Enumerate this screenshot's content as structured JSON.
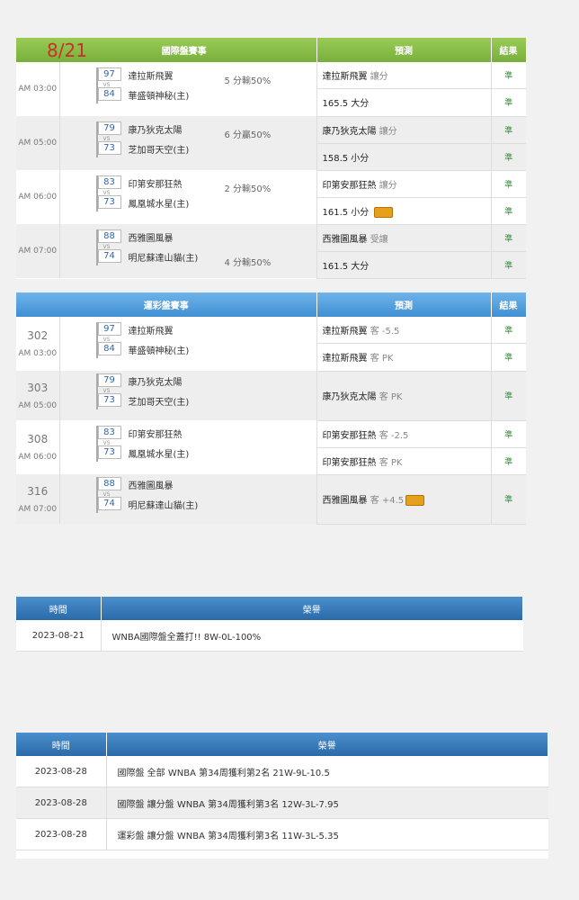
{
  "intl": {
    "date": "8/21",
    "col_match": "國際盤賽事",
    "col_pred": "預測",
    "col_result": "結果",
    "games": [
      {
        "time": "AM 03:00",
        "s1": "97",
        "s2": "84",
        "t1": "達拉斯飛翼",
        "t2": "華盛頓神秘(主)",
        "note": "5 分輸50%",
        "p1": "達拉斯飛翼",
        "p1s": "讓分",
        "p2": "165.5 大分",
        "p2s": "",
        "p2badge": false,
        "r1": "準",
        "r2": "準"
      },
      {
        "time": "AM 05:00",
        "s1": "79",
        "s2": "73",
        "t1": "康乃狄克太陽",
        "t2": "芝加哥天空(主)",
        "note": "6 分贏50%",
        "p1": "康乃狄克太陽",
        "p1s": "讓分",
        "p2": "158.5 小分",
        "p2s": "",
        "p2badge": false,
        "r1": "準",
        "r2": "準"
      },
      {
        "time": "AM 06:00",
        "s1": "83",
        "s2": "73",
        "t1": "印第安那狂熱",
        "t2": "鳳凰城水星(主)",
        "note": "2 分輸50%",
        "p1": "印第安那狂熱",
        "p1s": "讓分",
        "p2": "161.5 小分",
        "p2s": "",
        "p2badge": true,
        "r1": "準",
        "r2": "準"
      },
      {
        "time": "AM 07:00",
        "s1": "88",
        "s2": "74",
        "t1": "西雅圖風暴",
        "t2": "明尼蘇達山貓(主)",
        "note": "4 分輸50%",
        "p1": "西雅圖風暴",
        "p1s": "受讓",
        "p2": "161.5 大分",
        "p2s": "",
        "p2badge": false,
        "r1": "準",
        "r2": "準"
      }
    ]
  },
  "sport": {
    "col_match": "運彩盤賽事",
    "col_pred": "預測",
    "col_result": "結果",
    "games": [
      {
        "num": "302",
        "time": "AM 03:00",
        "s1": "97",
        "s2": "84",
        "t1": "達拉斯飛翼",
        "t2": "華盛頓神秘(主)",
        "p1": "達拉斯飛翼",
        "p1s": "客 -5.5",
        "p2": "達拉斯飛翼",
        "p2s": "客 PK",
        "r1": "準",
        "r2": "準"
      },
      {
        "num": "303",
        "time": "AM 05:00",
        "s1": "79",
        "s2": "73",
        "t1": "康乃狄克太陽",
        "t2": "芝加哥天空(主)",
        "p1": "康乃狄克太陽",
        "p1s": "客 PK",
        "r1": "準"
      },
      {
        "num": "308",
        "time": "AM 06:00",
        "s1": "83",
        "s2": "73",
        "t1": "印第安那狂熱",
        "t2": "鳳凰城水星(主)",
        "p1": "印第安那狂熱",
        "p1s": "客 -2.5",
        "p2": "印第安那狂熱",
        "p2s": "客 PK",
        "r1": "準",
        "r2": "準"
      },
      {
        "num": "316",
        "time": "AM 07:00",
        "s1": "88",
        "s2": "74",
        "t1": "西雅圖風暴",
        "t2": "明尼蘇達山貓(主)",
        "p1": "西雅圖風暴",
        "p1s": "客 +4.5",
        "p1badge": true,
        "r1": "準"
      }
    ]
  },
  "honor1": {
    "col_time": "時間",
    "col_honor": "榮譽",
    "rows": [
      {
        "date": "2023-08-21",
        "text": "WNBA國際盤全蓋打!! 8W-0L-100%"
      }
    ]
  },
  "honor2": {
    "col_time": "時間",
    "col_honor": "榮譽",
    "rows": [
      {
        "date": "2023-08-28",
        "text": "國際盤 全部 WNBA 第34周獲利第2名 21W-9L-10.5"
      },
      {
        "date": "2023-08-28",
        "text": "國際盤 讓分盤 WNBA 第34周獲利第3名 12W-3L-7.95"
      },
      {
        "date": "2023-08-28",
        "text": "運彩盤 讓分盤 WNBA 第34周獲利第3名 11W-3L-5.35"
      }
    ]
  }
}
